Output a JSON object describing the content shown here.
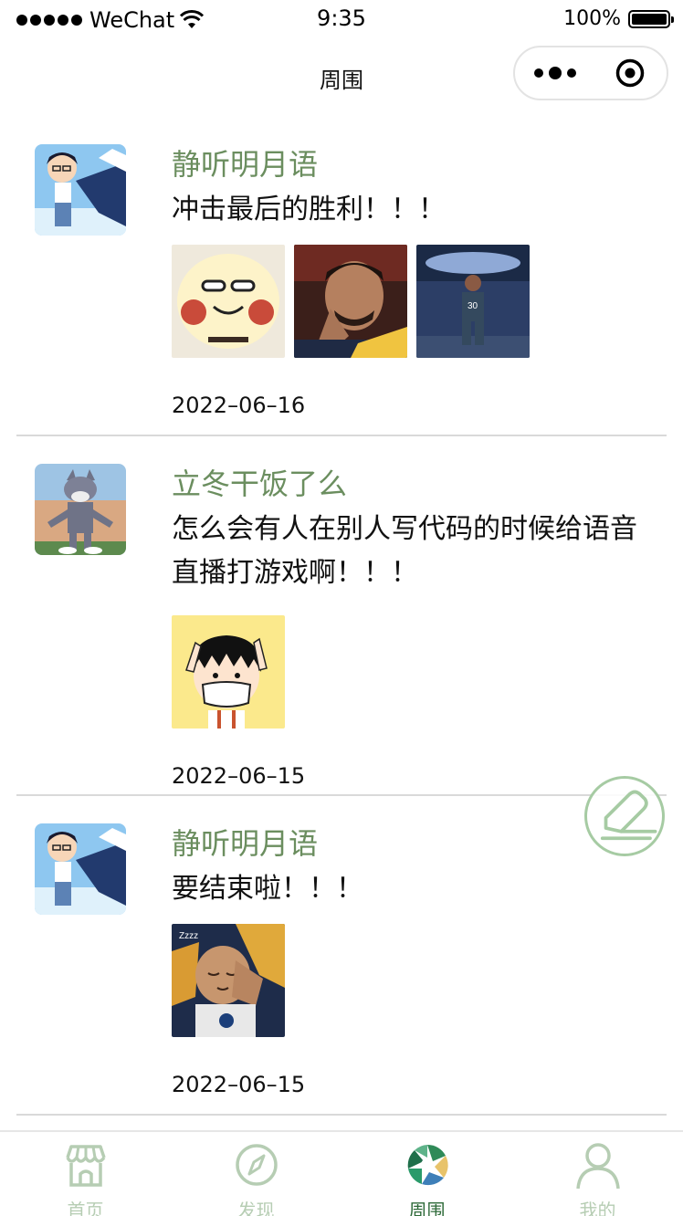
{
  "status_bar": {
    "carrier": "WeChat",
    "time": "9:35",
    "battery_percent": "100%",
    "battery_level": 1.0
  },
  "nav": {
    "title": "周围"
  },
  "posts": [
    {
      "author": "静听明月语",
      "content": "冲击最后的胜利！！！",
      "date": "2022–06–16",
      "avatar": "conan-avatar",
      "images": [
        "pigeon-sticker-image",
        "basketball-player-praying-image",
        "basketball-player-court-image"
      ]
    },
    {
      "author": "立冬干饭了么",
      "content": "怎么会有人在别人写代码的时候给语音直播打游戏啊！！！",
      "date": "2022–06–15",
      "avatar": "tom-cat-avatar",
      "images": [
        "masked-cartoon-kid-image"
      ]
    },
    {
      "author": "静听明月语",
      "content": "要结束啦！！！",
      "date": "2022–06–15",
      "avatar": "conan-avatar",
      "images": [
        "sleeping-player-cartoon-image"
      ]
    }
  ],
  "fab": {
    "icon": "edit-icon"
  },
  "tabs": [
    {
      "label": "首页",
      "icon": "home-icon",
      "active": false
    },
    {
      "label": "发现",
      "icon": "compass-icon",
      "active": false
    },
    {
      "label": "周围",
      "icon": "aperture-icon",
      "active": true
    },
    {
      "label": "我的",
      "icon": "user-icon",
      "active": false
    }
  ],
  "colors": {
    "author_green": "#6b8e5f",
    "tab_inactive": "#b6cdb3",
    "tab_active": "#2f6b3a",
    "fab_border": "#a6cba3"
  }
}
